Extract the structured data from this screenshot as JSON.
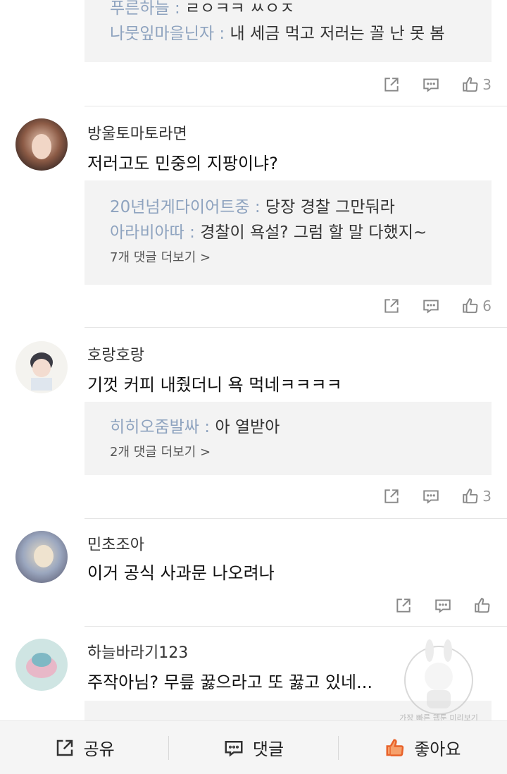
{
  "colors": {
    "reply_author": "#8ea3bf",
    "reply_bg": "#f3f3f3",
    "like_accent": "#e8622a"
  },
  "top_block": {
    "replies": [
      {
        "author": "푸른하늘",
        "sep": " : ",
        "text": "ㄹㅇㅋㅋ ㅆㅇㅈ"
      },
      {
        "author": "나뭇잎마을닌자",
        "sep": " : ",
        "text": "내 세금 먹고 저러는 꼴 난 못 봄"
      }
    ],
    "like_count": "3"
  },
  "comments": [
    {
      "author": "방울토마토라면",
      "text": "저러고도 민중의 지팡이냐?",
      "replies": [
        {
          "author": "20년넘게다이어트중",
          "sep": " : ",
          "text": "당장 경찰 그만둬라"
        },
        {
          "author": "아라비아따",
          "sep": " : ",
          "text": "경찰이 욕설? 그럼 할 말 다했지~"
        }
      ],
      "more": "7개 댓글 더보기 >",
      "like_count": "6"
    },
    {
      "author": "호랑호랑",
      "text": "기껏 커피 내줬더니 욕 먹네ㅋㅋㅋㅋ",
      "replies": [
        {
          "author": "히히오줌발싸",
          "sep": " : ",
          "text": "아 열받아"
        }
      ],
      "more": "2개 댓글 더보기 >",
      "like_count": "3"
    },
    {
      "author": "민초조아",
      "text": "이거 공식 사과문 나오려나"
    },
    {
      "author": "하늘바라기123",
      "text": "주작아님? 무릎 꿇으라고 또 꿇고 있네..."
    }
  ],
  "icons": {
    "share": "share-icon",
    "reply": "comment-icon",
    "like": "thumbs-up-icon"
  },
  "bottom_bar": {
    "share_label": "공유",
    "comment_label": "댓글",
    "like_label": "좋아요"
  },
  "watermark": {
    "text": "가장 빠른 웹툰 미리보기"
  }
}
